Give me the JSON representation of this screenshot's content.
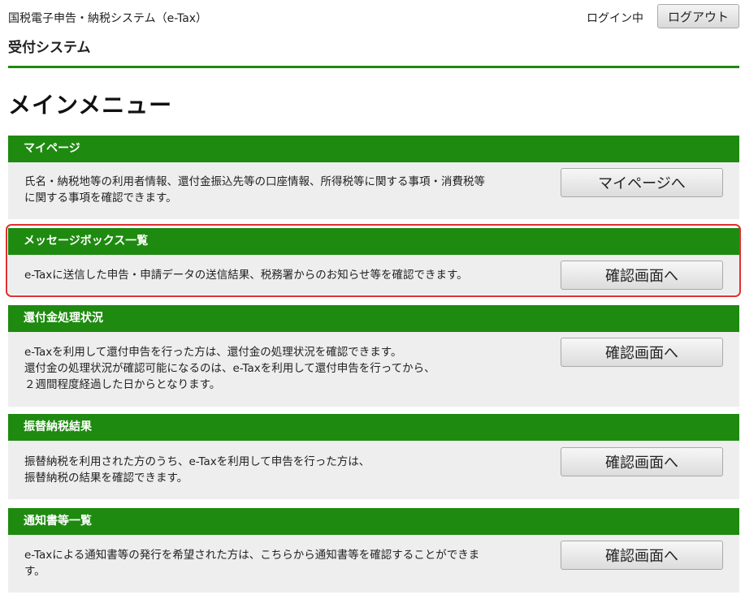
{
  "header": {
    "system_name": "国税電子申告・納税システム（e-Tax）",
    "sub_title": "受付システム",
    "login_status": "ログイン中",
    "logout_label": "ログアウト"
  },
  "page_title": "メインメニュー",
  "menu": [
    {
      "title": "マイページ",
      "description_lines": [
        "氏名・納税地等の利用者情報、還付金振込先等の口座情報、所得税等に関する事項・消費税等",
        "に関する事項を確認できます。"
      ],
      "button_label": "マイページへ"
    },
    {
      "title": "メッセージボックス一覧",
      "description_lines": [
        "e-Taxに送信した申告・申請データの送信結果、税務署からのお知らせ等を確認できます。"
      ],
      "button_label": "確認画面へ"
    },
    {
      "title": "還付金処理状況",
      "description_lines": [
        "e-Taxを利用して還付申告を行った方は、還付金の処理状況を確認できます。",
        "還付金の処理状況が確認可能になるのは、e-Taxを利用して還付申告を行ってから、",
        "２週間程度経過した日からとなります。"
      ],
      "button_label": "確認画面へ"
    },
    {
      "title": "振替納税結果",
      "description_lines": [
        "振替納税を利用された方のうち、e-Taxを利用して申告を行った方は、",
        "振替納税の結果を確認できます。"
      ],
      "button_label": "確認画面へ"
    },
    {
      "title": "通知書等一覧",
      "description_lines": [
        "e-Taxによる通知書等の発行を希望された方は、こちらから通知書等を確認することができま",
        "す。"
      ],
      "button_label": "確認画面へ"
    }
  ],
  "colors": {
    "accent_green": "#1e8a10",
    "highlight_red": "#e03030",
    "card_background": "#eeeeee"
  }
}
